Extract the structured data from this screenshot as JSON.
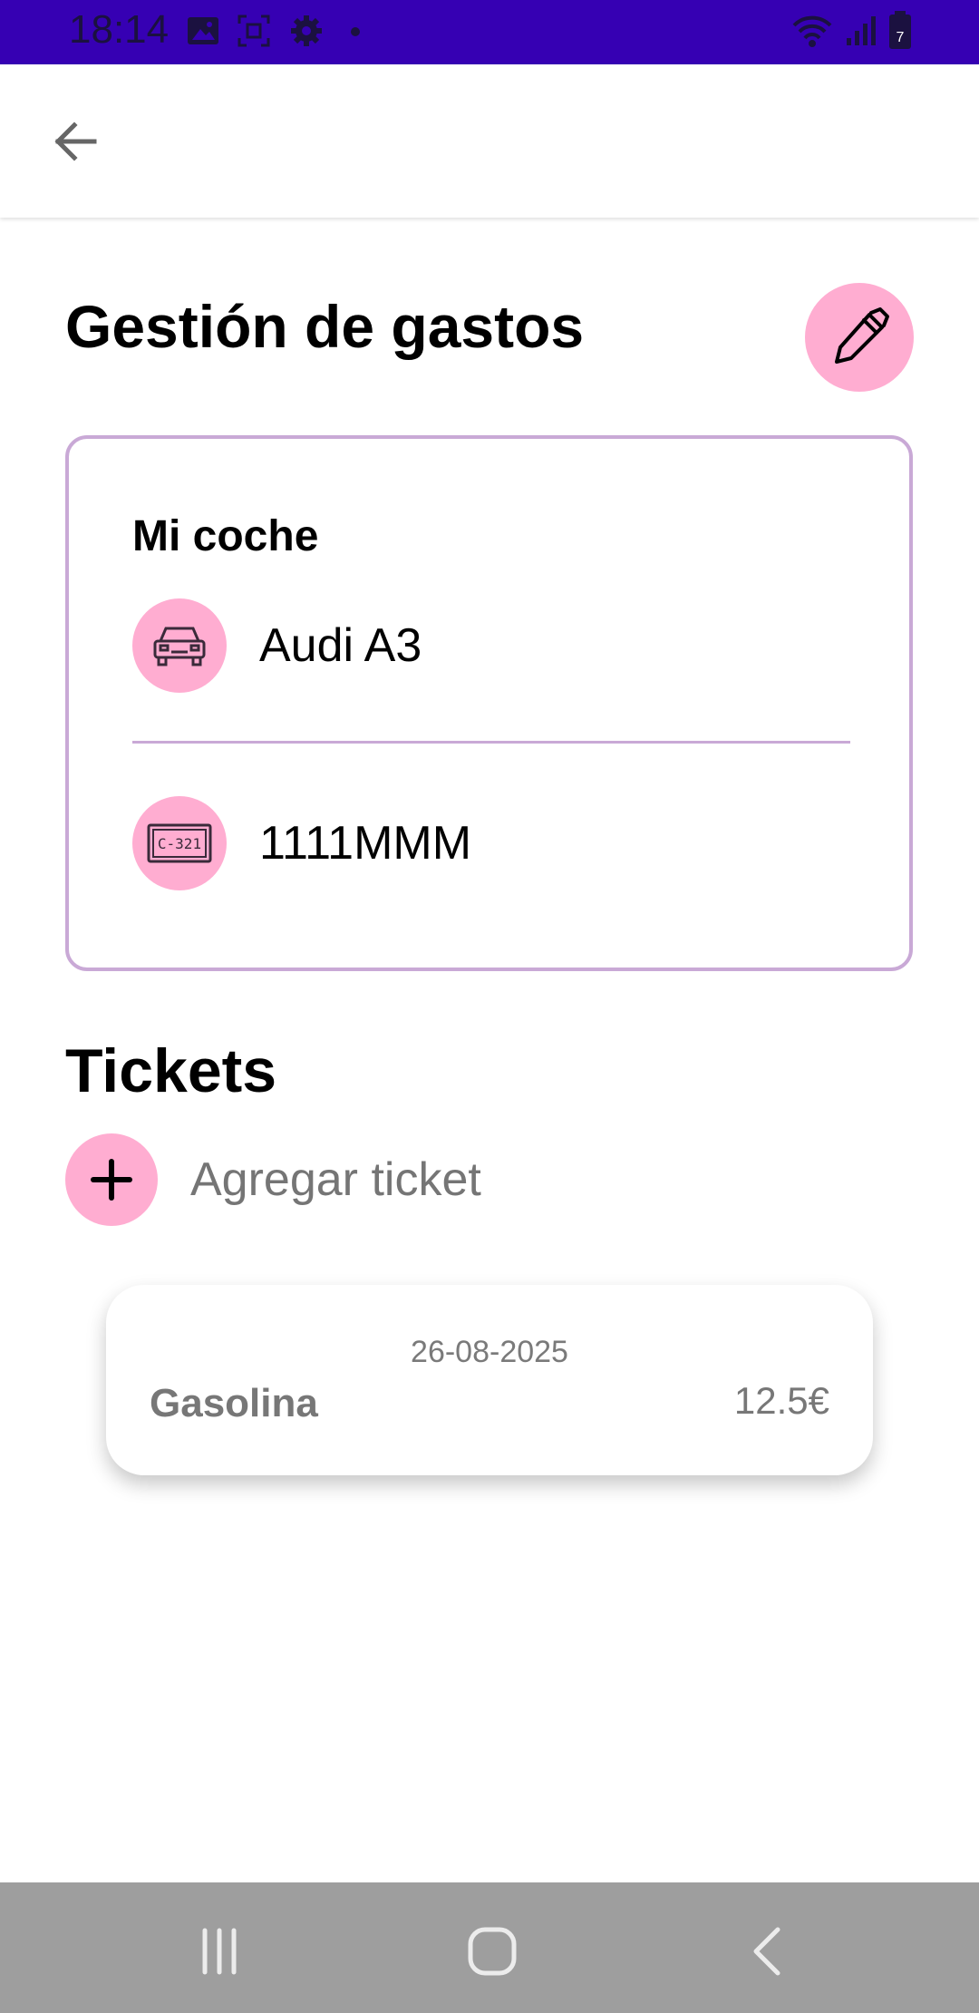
{
  "status_bar": {
    "time": "18:14",
    "left_icons": [
      "image-icon",
      "screenshot-icon",
      "gear-icon",
      "dot-icon"
    ],
    "right_icons": [
      "wifi-icon",
      "signal-icon",
      "battery-icon"
    ],
    "battery_level": "7",
    "background_color": "#3600b3"
  },
  "app_bar": {
    "back_icon": "arrow-left-icon"
  },
  "header": {
    "title": "Gestión de gastos",
    "edit_icon": "pen-icon"
  },
  "car_card": {
    "title": "Mi coche",
    "model": "Audi A3",
    "model_icon": "car-icon",
    "plate": "1111MMM",
    "plate_icon": "license-plate-icon",
    "plate_icon_text": "C-321"
  },
  "tickets": {
    "title": "Tickets",
    "add_label": "Agregar ticket",
    "items": [
      {
        "date": "26-08-2025",
        "name": "Gasolina",
        "amount": "12.5€"
      }
    ]
  },
  "nav_bar": {
    "buttons": [
      "recent-apps-icon",
      "home-icon",
      "back-icon"
    ]
  },
  "colors": {
    "accent_pink": "#ffadd1",
    "card_border": "#c9a9d6",
    "status_bar": "#3600b3",
    "nav_bar": "#9e9e9e"
  }
}
